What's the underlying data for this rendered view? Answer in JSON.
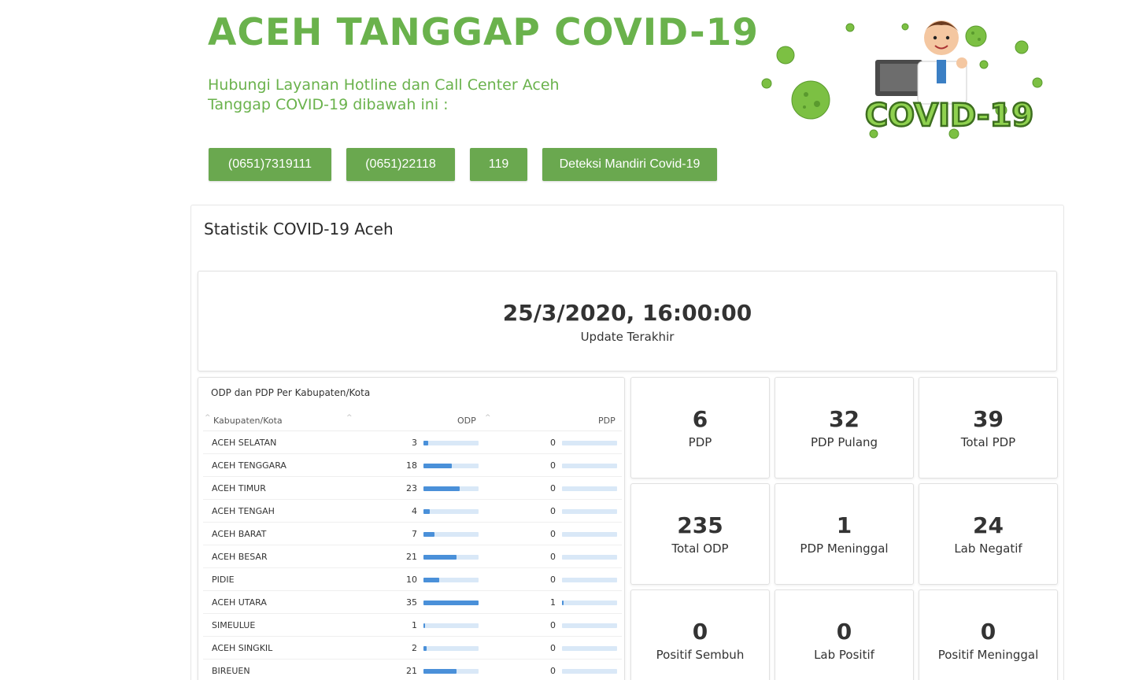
{
  "header": {
    "title": "ACEH TANGGAP COVID-19",
    "subtitle": "Hubungi Layanan Hotline dan Call Center Aceh Tanggap COVID-19 dibawah ini :",
    "logo_text": "COVID-19"
  },
  "hotlines": [
    {
      "label": "(0651)7319111"
    },
    {
      "label": "(0651)22118"
    },
    {
      "label": "119"
    },
    {
      "label": "Deteksi Mandiri Covid-19"
    }
  ],
  "panel": {
    "title": "Statistik COVID-19 Aceh"
  },
  "update": {
    "time": "25/3/2020, 16:00:00",
    "label": "Update Terakhir"
  },
  "table": {
    "title": "ODP dan PDP Per Kabupaten/Kota",
    "columns": [
      "Kabupaten/Kota",
      "ODP",
      "PDP"
    ],
    "odp_max": 35,
    "pdp_max": 35,
    "rows": [
      {
        "name": "ACEH SELATAN",
        "odp": 3,
        "pdp": 0
      },
      {
        "name": "ACEH TENGGARA",
        "odp": 18,
        "pdp": 0
      },
      {
        "name": "ACEH TIMUR",
        "odp": 23,
        "pdp": 0
      },
      {
        "name": "ACEH TENGAH",
        "odp": 4,
        "pdp": 0
      },
      {
        "name": "ACEH BARAT",
        "odp": 7,
        "pdp": 0
      },
      {
        "name": "ACEH BESAR",
        "odp": 21,
        "pdp": 0
      },
      {
        "name": "PIDIE",
        "odp": 10,
        "pdp": 0
      },
      {
        "name": "ACEH UTARA",
        "odp": 35,
        "pdp": 1
      },
      {
        "name": "SIMEULUE",
        "odp": 1,
        "pdp": 0
      },
      {
        "name": "ACEH SINGKIL",
        "odp": 2,
        "pdp": 0
      },
      {
        "name": "BIREUEN",
        "odp": 21,
        "pdp": 0
      }
    ]
  },
  "stats": [
    {
      "value": "6",
      "label": "PDP"
    },
    {
      "value": "32",
      "label": "PDP Pulang"
    },
    {
      "value": "39",
      "label": "Total PDP"
    },
    {
      "value": "235",
      "label": "Total ODP"
    },
    {
      "value": "1",
      "label": "PDP Meninggal"
    },
    {
      "value": "24",
      "label": "Lab Negatif"
    },
    {
      "value": "0",
      "label": "Positif Sembuh"
    },
    {
      "value": "0",
      "label": "Lab Positif"
    },
    {
      "value": "0",
      "label": "Positif Meninggal"
    }
  ],
  "colors": {
    "brand_green": "#6ab24c",
    "button_green": "#6aa84f",
    "bar_blue": "#4a90d9",
    "bar_track": "#d9e8f7"
  },
  "icons": {
    "virus": "virus-icon",
    "doctor": "doctor-illustration",
    "sort": "sort-caret-icon"
  }
}
